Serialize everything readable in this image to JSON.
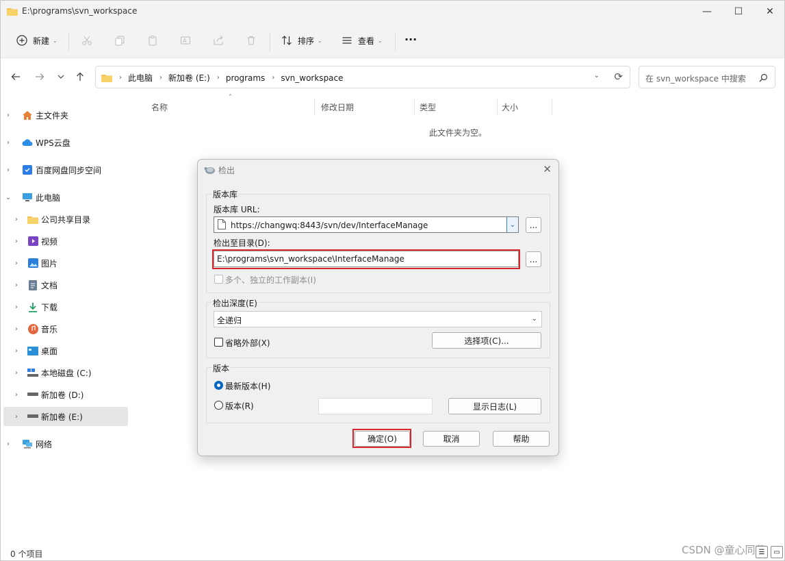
{
  "window": {
    "title": "E:\\programs\\svn_workspace",
    "controls": [
      "—",
      "☐",
      "✕"
    ]
  },
  "commandbar": {
    "new_label": "新建",
    "sort_label": "排序",
    "view_label": "查看",
    "more_label": "···"
  },
  "address": {
    "crumbs": [
      "此电脑",
      "新加卷 (E:)",
      "programs",
      "svn_workspace"
    ],
    "search_placeholder": "在 svn_workspace 中搜索"
  },
  "sidebar": {
    "items": [
      {
        "label": "主文件夹",
        "icon": "home-icon"
      },
      {
        "label": "WPS云盘",
        "icon": "cloud-icon"
      },
      {
        "label": "百度网盘同步空间",
        "icon": "baidu-sync-icon"
      },
      {
        "label": "此电脑",
        "icon": "computer-icon"
      },
      {
        "label": "公司共享目录",
        "icon": "folder-icon"
      },
      {
        "label": "视频",
        "icon": "video-icon"
      },
      {
        "label": "图片",
        "icon": "picture-icon"
      },
      {
        "label": "文档",
        "icon": "document-icon"
      },
      {
        "label": "下载",
        "icon": "download-icon"
      },
      {
        "label": "音乐",
        "icon": "music-icon"
      },
      {
        "label": "桌面",
        "icon": "desktop-icon"
      },
      {
        "label": "本地磁盘 (C:)",
        "icon": "drive-c-icon"
      },
      {
        "label": "新加卷 (D:)",
        "icon": "drive-icon"
      },
      {
        "label": "新加卷 (E:)",
        "icon": "drive-icon"
      },
      {
        "label": "网络",
        "icon": "network-icon"
      }
    ]
  },
  "filelist": {
    "columns": [
      "名称",
      "修改日期",
      "类型",
      "大小"
    ],
    "empty_message": "此文件夹为空。"
  },
  "status": {
    "count": "0 个项目",
    "watermark": "CSDN @童心同萌"
  },
  "dialog": {
    "title": "检出",
    "repo_group": "版本库",
    "repo_url_label": "版本库 URL:",
    "repo_url": "https://changwq:8443/svn/dev/InterfaceManage",
    "checkout_dir_label": "检出至目录(D):",
    "checkout_dir": "E:\\programs\\svn_workspace\\InterfaceManage",
    "browse_label": "...",
    "multi_wc_label": "多个、独立的工作副本(I)",
    "depth_group": "检出深度(E)",
    "depth_value": "全递归",
    "omit_externals_label": "省略外部(X)",
    "choose_items_label": "选择项(C)...",
    "revision_group": "版本",
    "head_label": "最新版本(H)",
    "revision_label": "版本(R)",
    "revision_value": "",
    "show_log_label": "显示日志(L)",
    "ok_label": "确定(O)",
    "cancel_label": "取消",
    "help_label": "帮助"
  },
  "colors": {
    "highlight_red": "#d9262c",
    "selected_bg": "#e5e5e5",
    "accent_blue": "#0067c0"
  }
}
